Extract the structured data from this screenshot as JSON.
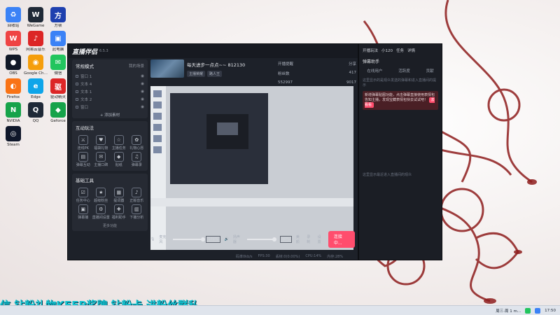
{
  "desktop": {
    "icons": [
      {
        "label": "回收站",
        "glyph": "♻",
        "color": "#3b82f6"
      },
      {
        "label": "WeGame",
        "glyph": "W",
        "color": "#1f2937"
      },
      {
        "label": "方顿",
        "glyph": "方",
        "color": "#1e40af"
      },
      {
        "label": "WPS",
        "glyph": "W",
        "color": "#ef4444"
      },
      {
        "label": "网易云音乐",
        "glyph": "♪",
        "color": "#dc2626"
      },
      {
        "label": "此电脑",
        "glyph": "▣",
        "color": "#3b82f6"
      },
      {
        "label": "OBS",
        "glyph": "●",
        "color": "#111827"
      },
      {
        "label": "Google Chrome",
        "glyph": "◉",
        "color": "#f59e0b"
      },
      {
        "label": "微信",
        "glyph": "✉",
        "color": "#22c55e"
      },
      {
        "label": "Firefox",
        "glyph": "◐",
        "color": "#f97316"
      },
      {
        "label": "Edge",
        "glyph": "e",
        "color": "#0ea5e9"
      },
      {
        "label": "驱动精灵",
        "glyph": "驱",
        "color": "#dc2626"
      },
      {
        "label": "NVIDIA",
        "glyph": "N",
        "color": "#16a34a"
      },
      {
        "label": "QQ",
        "glyph": "Q",
        "color": "#1f2937"
      },
      {
        "label": "Geforce",
        "glyph": "◆",
        "color": "#16a34a"
      },
      {
        "label": "Steam",
        "glyph": "◎",
        "color": "#0f172a"
      }
    ]
  },
  "app": {
    "title": "直播伴侣",
    "version": "6.5.3",
    "mode_label": "常规模式",
    "scenes_header": "我的场景",
    "scenes": [
      "窗口 1",
      "文本 4",
      "文本 1",
      "文本 2",
      "窗口"
    ],
    "add_scene": "+ 添加素材",
    "interact_header": "互动玩法",
    "interact_tools": [
      "连线PK",
      "福袋礼物",
      "主播任务",
      "礼物心愿",
      "弹幕互动",
      "主播口碑",
      "贴纸",
      "弹幕录"
    ],
    "basic_header": "基础工具",
    "basic_tools": [
      "任务中心",
      "超级粉丝",
      "提词器",
      "正版音乐",
      "弹幕播",
      "直播间设置",
      "福利助手",
      "下播分析"
    ],
    "more": "更多功能",
    "live_title": "每天进步一点点~~ 812130",
    "live_tag1": "主播荣耀",
    "live_tag2": "路人王",
    "stat_open": "开播提醒",
    "stat_share": "分享",
    "stat_fans": "粉丝数",
    "stat_likes": "本场点赞",
    "stat_val1": "417",
    "stat_val2": "552997",
    "stat_val3": "9017",
    "mic_label": "麦克风",
    "mic_pct": "170%",
    "speaker_label": "扬声器",
    "speaker_pct": "90%",
    "tool_beauty": "美颜",
    "tool_rec": "录制",
    "tool_set": "设置",
    "go_live": "连接中...",
    "status": [
      "码率0kb/s",
      "FPS:30",
      "丢帧:0(0.00%)",
      "CPU:14%",
      "内存:28%"
    ]
  },
  "danmaku": {
    "tabs": [
      "开播玩法",
      "小120",
      "任务",
      "详情"
    ],
    "helper": "弹幕助手",
    "sub_tabs": [
      "在线用户",
      "活跃度",
      "贡献"
    ],
    "tip": "这里显示的是观众发送的弹幕和进入直播间的提示",
    "notice": "新增弹幕贴图功能，点击弹幕直接使用表情包告知主播，发现宝藏表情包快去试试吧！",
    "notice_btn": "去看看",
    "footer": "这里显示最近进入直播间的观众"
  },
  "banner": "信 钻粉礼物KEEP奖牌 钻粉卡 进粉丝群私",
  "taskbar": {
    "time": "17:50",
    "date_hint": "周三·周 1 m..."
  }
}
